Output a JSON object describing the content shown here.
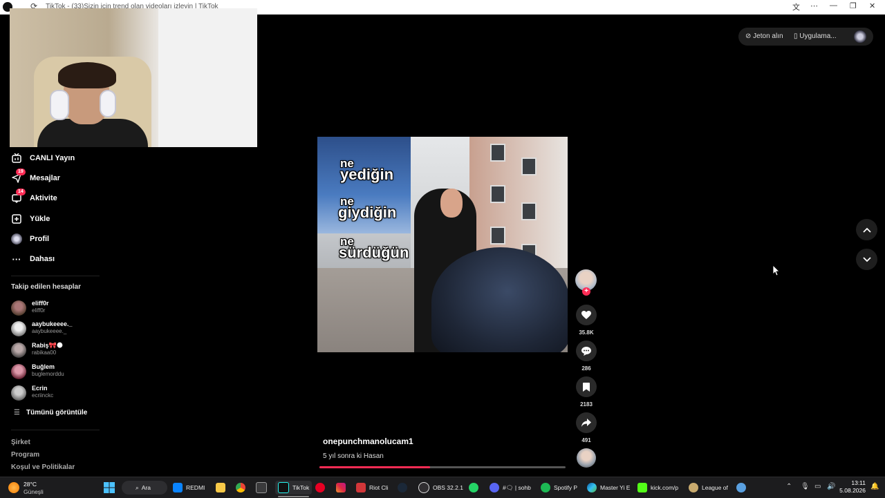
{
  "browser": {
    "tab_title": "TikTok - (33)Sizin için trend olan videoları izleyin | TikTok"
  },
  "sidebar": {
    "items": [
      {
        "label": "CANLI Yayın",
        "icon": "live-tv-icon"
      },
      {
        "label": "Mesajlar",
        "icon": "paper-plane-icon",
        "badge": "19"
      },
      {
        "label": "Aktivite",
        "icon": "activity-icon",
        "badge": "14"
      },
      {
        "label": "Yükle",
        "icon": "upload-plus-icon"
      },
      {
        "label": "Profil",
        "icon": "profile-avatar-icon"
      },
      {
        "label": "Dahası",
        "icon": "more-dots-icon"
      }
    ],
    "following_title": "Takip edilen hesaplar",
    "following": [
      {
        "name": "eliff0r",
        "handle": "eliff0r"
      },
      {
        "name": "aaybukeeee._",
        "handle": "aaybukeeee._"
      },
      {
        "name": "Rabiş🎀🌑",
        "handle": "rabikaa00"
      },
      {
        "name": "Buğlem",
        "handle": "buglemorddu"
      },
      {
        "name": "Ecrin",
        "handle": "ecriinckc"
      }
    ],
    "see_all": "Tümünü görüntüle",
    "footer": [
      "Şirket",
      "Program",
      "Koşul ve Politikalar"
    ]
  },
  "top_right": {
    "coins": "Jeton alın",
    "app": "Uygulama..."
  },
  "video": {
    "captions": [
      "ne",
      "yediğin",
      "ne",
      "giydiğin",
      "ne",
      "sürdüğün"
    ],
    "author": "onepunchmanolucam1",
    "description": "5 yıl sonra ki Hasan",
    "progress": 0.45
  },
  "actions": {
    "likes": "35.8K",
    "comments": "286",
    "saves": "2183",
    "shares": "491"
  },
  "taskbar": {
    "weather_temp": "28°C",
    "weather_desc": "Güneşli",
    "search": "Ara",
    "apps": [
      "REDMI",
      "TikTok",
      "Riot Cli",
      "OBS 32.2.1",
      "#🗨 | sohb",
      "Spotify P",
      "Master Yi E",
      "kick.com/p",
      "League of"
    ],
    "time": "13:11",
    "date": "5.08.2026"
  }
}
